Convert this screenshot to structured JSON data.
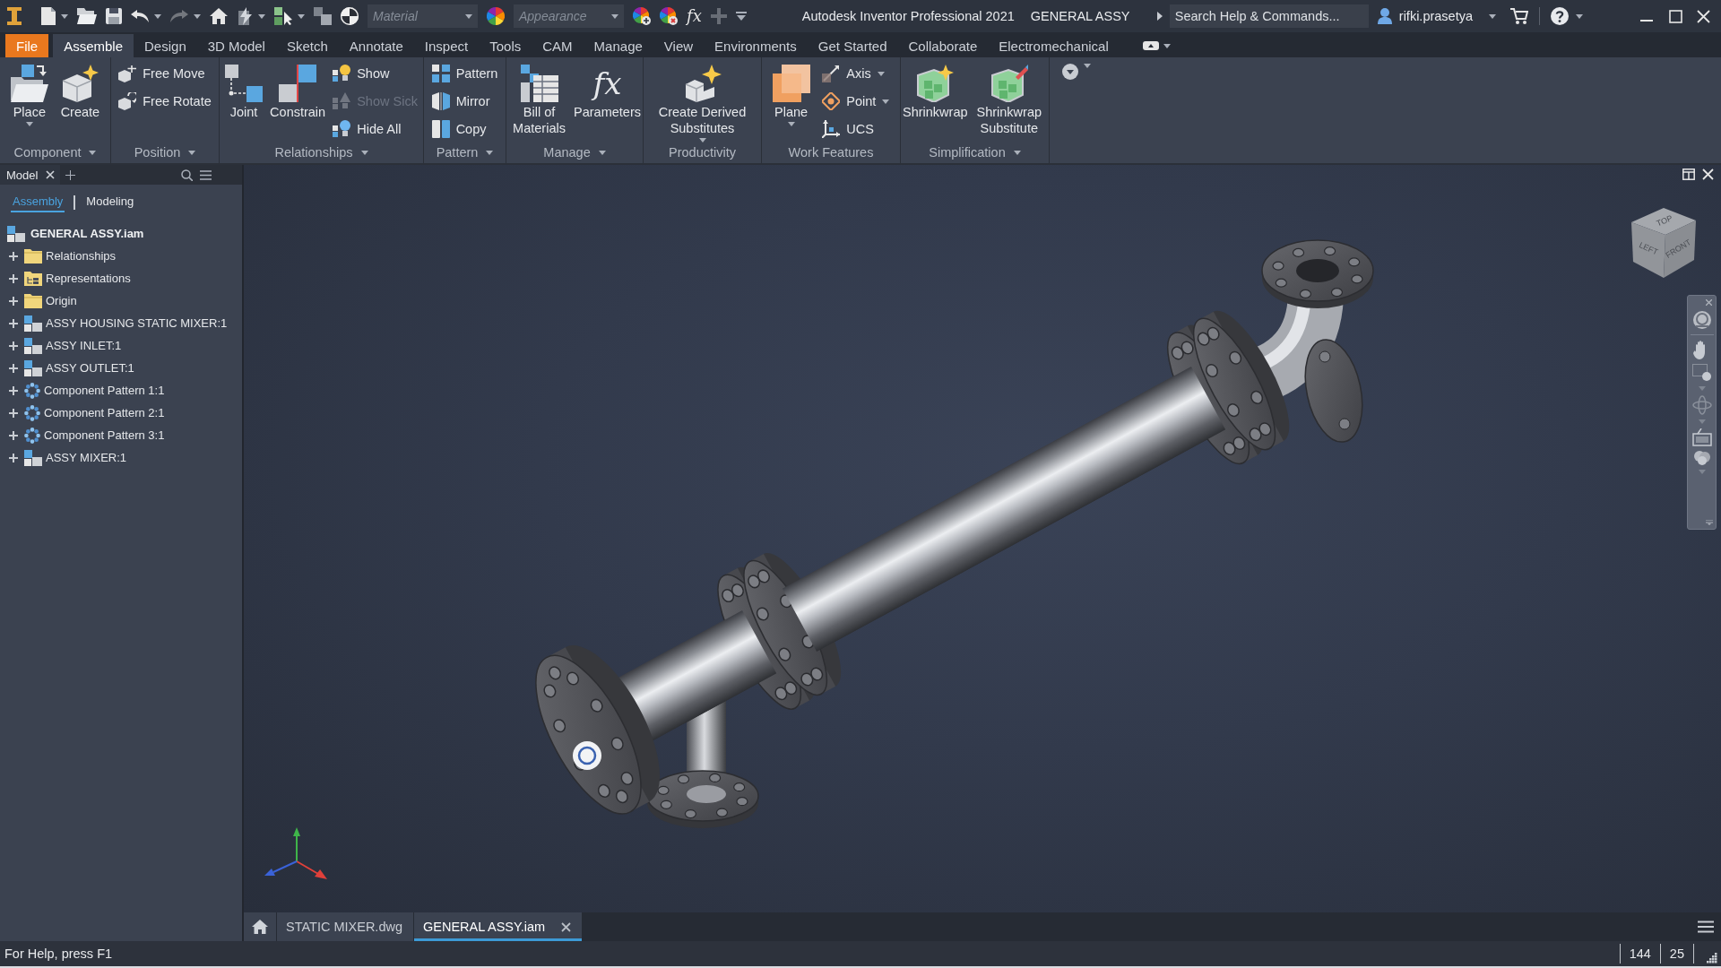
{
  "title_bar": {
    "quick_access": [
      {
        "kind": "split",
        "disabled": false
      },
      {
        "kind": "button",
        "disabled": false
      },
      {
        "kind": "button",
        "disabled": false
      },
      {
        "kind": "split",
        "disabled": false
      },
      {
        "kind": "split",
        "disabled": true
      },
      {
        "kind": "button",
        "disabled": false
      },
      {
        "kind": "split",
        "disabled": false
      },
      {
        "kind": "split",
        "disabled": false
      },
      {
        "kind": "button",
        "disabled": false
      },
      {
        "kind": "button",
        "disabled": false
      },
      {
        "kind": "select",
        "placeholder": "Material"
      },
      {
        "kind": "button",
        "disabled": false
      },
      {
        "kind": "select",
        "placeholder": "Appearance"
      },
      {
        "kind": "button",
        "disabled": false
      },
      {
        "kind": "button",
        "disabled": false
      },
      {
        "kind": "glyph",
        "label": "fx",
        "disabled": false
      },
      {
        "kind": "button",
        "disabled": true
      },
      {
        "kind": "button",
        "disabled": false
      }
    ],
    "title": "Autodesk Inventor Professional 2021",
    "document": "GENERAL ASSY",
    "search": {
      "placeholder": "Search Help & Commands..."
    },
    "user": "rifki.prasetya"
  },
  "ribbon_tabs": [
    {
      "label": "File",
      "kind": "file",
      "selected": false
    },
    {
      "label": "Assemble",
      "kind": "tab",
      "selected": true
    },
    {
      "label": "Design",
      "kind": "tab",
      "selected": false
    },
    {
      "label": "3D Model",
      "kind": "tab",
      "selected": false
    },
    {
      "label": "Sketch",
      "kind": "tab",
      "selected": false
    },
    {
      "label": "Annotate",
      "kind": "tab",
      "selected": false
    },
    {
      "label": "Inspect",
      "kind": "tab",
      "selected": false
    },
    {
      "label": "Tools",
      "kind": "tab",
      "selected": false
    },
    {
      "label": "CAM",
      "kind": "tab",
      "selected": false
    },
    {
      "label": "Manage",
      "kind": "tab",
      "selected": false
    },
    {
      "label": "View",
      "kind": "tab",
      "selected": false
    },
    {
      "label": "Environments",
      "kind": "tab",
      "selected": false
    },
    {
      "label": "Get Started",
      "kind": "tab",
      "selected": false
    },
    {
      "label": "Collaborate",
      "kind": "tab",
      "selected": false
    },
    {
      "label": "Electromechanical",
      "kind": "tab",
      "selected": false
    }
  ],
  "ribbon_panels": [
    {
      "label": "Component",
      "menu": true,
      "tools": [
        {
          "label": "Place",
          "kind": "large",
          "dropdown": true,
          "disabled": false
        },
        {
          "label": "Create",
          "kind": "large",
          "dropdown": false,
          "disabled": false
        }
      ]
    },
    {
      "label": "Position",
      "menu": true,
      "tools": [
        {
          "label": "Free Move",
          "kind": "small",
          "dropdown": false,
          "disabled": false
        },
        {
          "label": "Free Rotate",
          "kind": "small",
          "dropdown": false,
          "disabled": false
        }
      ]
    },
    {
      "label": "Relationships",
      "menu": true,
      "tools": [
        {
          "label": "Joint",
          "kind": "large",
          "dropdown": false,
          "disabled": false
        },
        {
          "label": "Constrain",
          "kind": "large",
          "dropdown": false,
          "disabled": false
        },
        {
          "label": "Show",
          "kind": "small",
          "dropdown": false,
          "disabled": false
        },
        {
          "label": "Show Sick",
          "kind": "small",
          "dropdown": false,
          "disabled": true
        },
        {
          "label": "Hide All",
          "kind": "small",
          "dropdown": false,
          "disabled": false
        }
      ]
    },
    {
      "label": "Pattern",
      "menu": true,
      "tools": [
        {
          "label": "Pattern",
          "kind": "small",
          "dropdown": false,
          "disabled": false
        },
        {
          "label": "Mirror",
          "kind": "small",
          "dropdown": false,
          "disabled": false
        },
        {
          "label": "Copy",
          "kind": "small",
          "dropdown": false,
          "disabled": false
        }
      ]
    },
    {
      "label": "Manage",
      "menu": true,
      "tools": [
        {
          "label": "Bill of Materials",
          "kind": "large",
          "dropdown": false,
          "disabled": false
        },
        {
          "label": "Parameters",
          "kind": "large",
          "glyph": "fx",
          "dropdown": false,
          "disabled": false
        }
      ]
    },
    {
      "label": "Productivity",
      "menu": false,
      "tools": [
        {
          "label": "Create Derived Substitutes",
          "kind": "large",
          "dropdown": true,
          "disabled": false
        }
      ]
    },
    {
      "label": "Work Features",
      "menu": false,
      "tools": [
        {
          "label": "Plane",
          "kind": "large",
          "dropdown": true,
          "disabled": false
        },
        {
          "label": "Axis",
          "kind": "small",
          "dropdown": true,
          "disabled": false
        },
        {
          "label": "Point",
          "kind": "small",
          "dropdown": true,
          "disabled": false
        },
        {
          "label": "UCS",
          "kind": "small",
          "dropdown": false,
          "disabled": false
        }
      ]
    },
    {
      "label": "Simplification",
      "menu": true,
      "tools": [
        {
          "label": "Shrinkwrap",
          "kind": "large",
          "dropdown": false,
          "disabled": false
        },
        {
          "label": "Shrinkwrap Substitute",
          "kind": "large",
          "dropdown": false,
          "disabled": false
        }
      ]
    }
  ],
  "browser": {
    "title": "Model",
    "tabs": [
      {
        "label": "Assembly",
        "selected": true
      },
      {
        "label": "Modeling",
        "selected": false
      }
    ],
    "tree": {
      "label": "GENERAL ASSY.iam",
      "children": [
        {
          "label": "Relationships",
          "kind": "folder",
          "expanded": false
        },
        {
          "label": "Representations",
          "kind": "representations",
          "expanded": false
        },
        {
          "label": "Origin",
          "kind": "folder",
          "expanded": false
        },
        {
          "label": "ASSY HOUSING STATIC MIXER:1",
          "kind": "assembly",
          "expanded": false
        },
        {
          "label": "ASSY INLET:1",
          "kind": "assembly",
          "expanded": false
        },
        {
          "label": "ASSY OUTLET:1",
          "kind": "assembly",
          "expanded": false
        },
        {
          "label": "Component Pattern 1:1",
          "kind": "pattern",
          "expanded": false
        },
        {
          "label": "Component Pattern 2:1",
          "kind": "pattern",
          "expanded": false
        },
        {
          "label": "Component Pattern 3:1",
          "kind": "pattern",
          "expanded": false
        },
        {
          "label": "ASSY MIXER:1",
          "kind": "assembly",
          "expanded": false
        }
      ]
    }
  },
  "viewport": {
    "view_cube": {
      "faces": [
        "TOP",
        "LEFT",
        "FRONT"
      ]
    }
  },
  "document_tabs": [
    {
      "label": "STATIC MIXER.dwg",
      "selected": false
    },
    {
      "label": "GENERAL ASSY.iam",
      "selected": true
    }
  ],
  "status_bar": {
    "help": "For Help, press F1",
    "counts": [
      "144",
      "25"
    ]
  }
}
